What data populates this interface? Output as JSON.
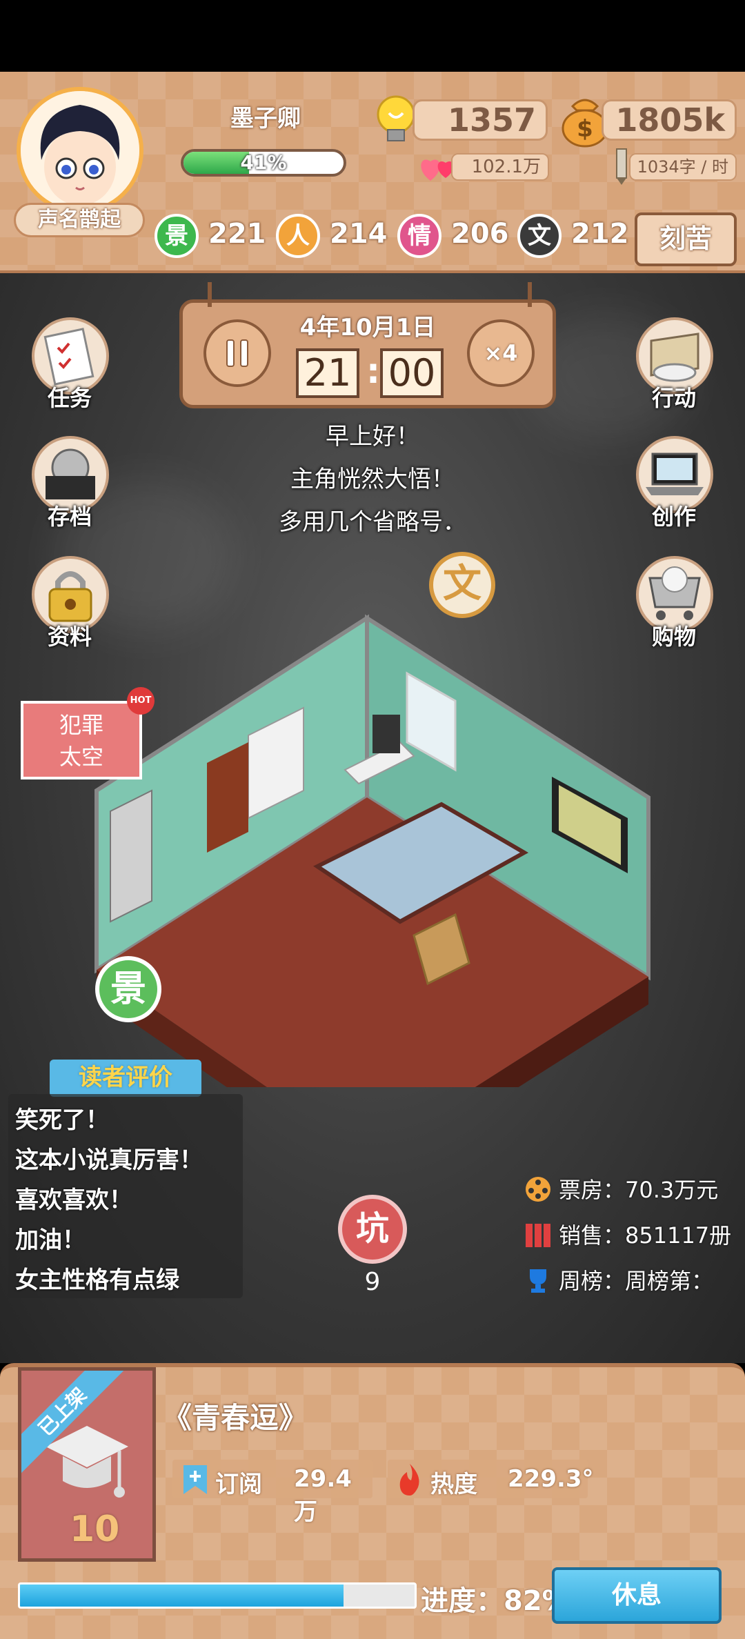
{
  "player": {
    "name": "墨子卿",
    "fame_title": "声名鹊起",
    "xp_percent_label": "41%",
    "xp_fraction": 0.41
  },
  "resources": {
    "inspiration": "1357",
    "money": "1805k",
    "fans": "102.1万",
    "speed": "1034字 / 时"
  },
  "stats": [
    {
      "glyph": "景",
      "value": "221",
      "color": "#3db84d"
    },
    {
      "glyph": "人",
      "value": "214",
      "color": "#f2a33a"
    },
    {
      "glyph": "情",
      "value": "206",
      "color": "#e0558c"
    },
    {
      "glyph": "文",
      "value": "212",
      "color": "#3a3a3a"
    }
  ],
  "hard_work_label": "刻苦",
  "clock": {
    "date": "4年10月1日",
    "hour": "21",
    "minute": "00",
    "speed_label": "×4"
  },
  "side_left": [
    {
      "label": "任务",
      "icon": "task-icon"
    },
    {
      "label": "存档",
      "icon": "save-icon"
    },
    {
      "label": "资料",
      "icon": "lock-icon"
    }
  ],
  "side_right": [
    {
      "label": "行动",
      "icon": "action-icon"
    },
    {
      "label": "创作",
      "icon": "laptop-icon"
    },
    {
      "label": "购物",
      "icon": "cart-icon"
    }
  ],
  "message_lines": [
    "早上好！",
    "主角恍然大悟！",
    "多用几个省略号．"
  ],
  "bubbles": {
    "wen": "文",
    "jing": "景"
  },
  "event_card": {
    "line1": "犯罪",
    "line2": "太空",
    "tag": "HOT"
  },
  "reviews": {
    "title": "读者评价",
    "lines": [
      "笑死了！",
      "这本小说真厉害！",
      "喜欢喜欢！",
      "加油！",
      "女主性格有点绿"
    ]
  },
  "pit": {
    "glyph": "坑",
    "count": "9"
  },
  "book_stats": [
    {
      "label": "票房：70.3万元",
      "icon": "film-reel-icon",
      "color": "#f2a33a"
    },
    {
      "label": "销售：851117册",
      "icon": "books-icon",
      "color": "#e04040"
    },
    {
      "label": "周榜：周榜第：",
      "icon": "trophy-icon",
      "color": "#1e7ae0"
    }
  ],
  "book": {
    "ribbon": "已上架",
    "level": "10",
    "title": "《青春逗》",
    "subscribe_label": "订阅",
    "subscribe_value": "29.4万",
    "heat_label": "热度",
    "heat_value": "229.3°",
    "progress_label": "进度：82%",
    "progress_fraction": 0.82,
    "rest_label": "休息"
  }
}
